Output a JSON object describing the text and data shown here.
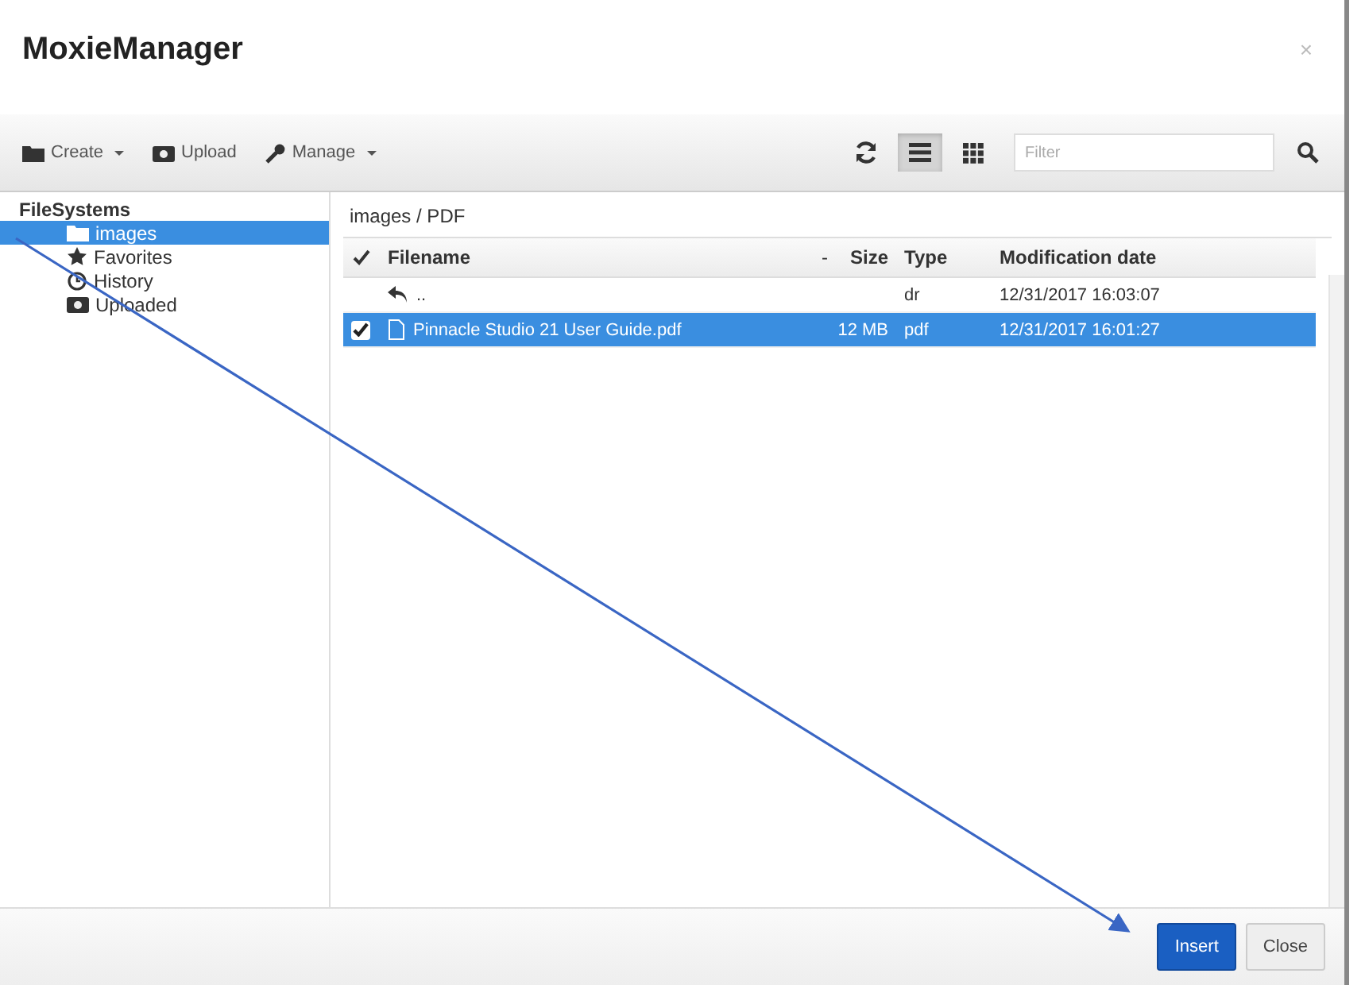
{
  "window": {
    "title": "MoxieManager",
    "close": "×"
  },
  "toolbar": {
    "actions": [
      {
        "label": "Create",
        "kind": "folder",
        "dropdown": true
      },
      {
        "label": "Upload",
        "kind": "upload",
        "dropdown": false
      },
      {
        "label": "Manage",
        "kind": "wrench",
        "dropdown": true
      }
    ],
    "view_modes": [
      {
        "kind": "list",
        "selected": true
      },
      {
        "kind": "grid",
        "selected": false
      }
    ],
    "filter": {
      "placeholder": "Filter"
    }
  },
  "sidebar": {
    "heading": "FileSystems",
    "items": [
      {
        "label": "images",
        "kind": "folder",
        "selected": true
      },
      {
        "label": "Favorites",
        "kind": "star",
        "selected": false
      },
      {
        "label": "History",
        "kind": "clock",
        "selected": false
      },
      {
        "label": "Uploaded",
        "kind": "upload",
        "selected": false
      }
    ]
  },
  "breadcrumb": "images / PDF",
  "table": {
    "columns": [
      {
        "label": "Filename"
      },
      {
        "label": "Size",
        "sort_mark": "-"
      },
      {
        "label": "Type"
      },
      {
        "label": "Modification date"
      }
    ],
    "rows": [
      {
        "kind": "parent",
        "name": "..",
        "type": "dr",
        "date": "12/31/2017 16:03:07",
        "selected": false
      },
      {
        "kind": "file",
        "name": "Pinnacle Studio 21 User Guide.pdf",
        "size": "12 MB",
        "type": "pdf",
        "date": "12/31/2017 16:01:27",
        "selected": true
      }
    ]
  },
  "buttons": [
    {
      "label": "Insert",
      "kind": "primary"
    },
    {
      "label": "Close",
      "kind": "default"
    }
  ]
}
